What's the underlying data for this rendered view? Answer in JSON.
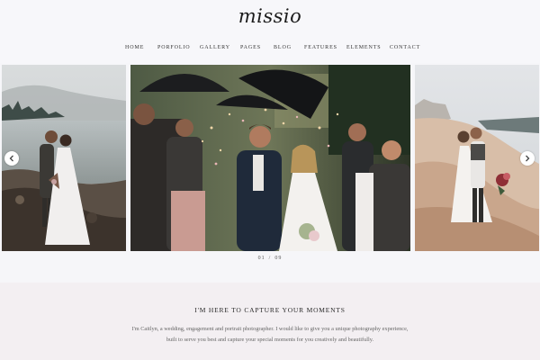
{
  "site": {
    "logo": "missio"
  },
  "nav": {
    "items": [
      {
        "label": "HOME"
      },
      {
        "label": "PORFOLIO"
      },
      {
        "label": "GALLERY"
      },
      {
        "label": "PAGES"
      },
      {
        "label": "BLOG"
      },
      {
        "label": "FEATURES"
      },
      {
        "label": "ELEMENTS"
      },
      {
        "label": "CONTACT"
      }
    ]
  },
  "slider": {
    "current": "01",
    "separator": "/",
    "total": "09",
    "prev_icon": "chevron-left-icon",
    "next_icon": "chevron-right-icon"
  },
  "about": {
    "title": "I'M HERE TO CAPTURE YOUR MOMENTS",
    "text_line1": "I'm Caitlyn, a wedding, engagement and portrait photographer. I would like to give you a unique photography experience,",
    "text_line2": "built to serve you best and capture your special moments for you creatively and beautifully."
  }
}
